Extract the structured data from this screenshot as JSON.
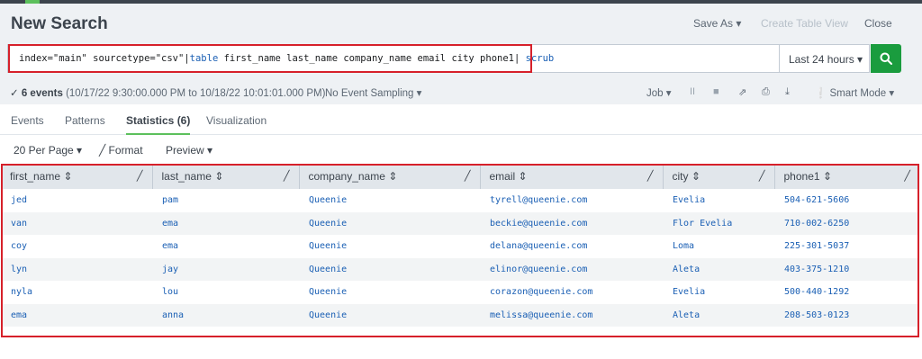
{
  "header": {
    "title": "New Search",
    "save_as": "Save As ▾",
    "create_table_view": "Create Table View",
    "close": "Close"
  },
  "search": {
    "query_prefix": "index=\"main\" sourcetype=\"csv\"|",
    "query_cmd1": "table",
    "query_mid": " first_name last_name company_name email city phone1| ",
    "query_cmd2": "scrub",
    "time_range": "Last 24 hours ▾",
    "go_icon": "search-icon"
  },
  "status": {
    "check": "✓",
    "event_count": "6 events",
    "range": " (10/17/22 9:30:00.000 PM to 10/18/22 10:01:01.000 PM)",
    "sampling": "No Event Sampling ▾",
    "job": "Job ▾",
    "pause_icon": "II",
    "stop_icon": "■",
    "share_icon": "⇗",
    "print_icon": "⎙",
    "export_icon": "⤓",
    "mode": "❕ Smart Mode ▾"
  },
  "tabs": {
    "events": "Events",
    "patterns": "Patterns",
    "statistics": "Statistics (6)",
    "visualization": "Visualization"
  },
  "toolbar": {
    "per_page": "20 Per Page ▾",
    "format": "╱ Format",
    "preview": "Preview ▾"
  },
  "table": {
    "columns": [
      "first_name ⇕",
      "last_name ⇕",
      "company_name ⇕",
      "email ⇕",
      "city ⇕",
      "phone1 ⇕"
    ],
    "pencil": "╱",
    "rows": [
      [
        "jed",
        "pam",
        "Queenie",
        "tyrell@queenie.com",
        "Evelia",
        "504-621-5606"
      ],
      [
        "van",
        "ema",
        "Queenie",
        "beckie@queenie.com",
        "Flor Evelia",
        "710-002-6250"
      ],
      [
        "coy",
        "ema",
        "Queenie",
        "delana@queenie.com",
        "Loma",
        "225-301-5037"
      ],
      [
        "lyn",
        "jay",
        "Queenie",
        "elinor@queenie.com",
        "Aleta",
        "403-375-1210"
      ],
      [
        "nyla",
        "lou",
        "Queenie",
        "corazon@queenie.com",
        "Evelia",
        "500-440-1292"
      ],
      [
        "ema",
        "anna",
        "Queenie",
        "melissa@queenie.com",
        "Aleta",
        "208-503-0123"
      ]
    ]
  },
  "colors": {
    "accent_green": "#5cc05c",
    "go_button": "#1a9c3e",
    "highlight_red": "#d6202a",
    "link_blue": "#1a5fb4"
  }
}
